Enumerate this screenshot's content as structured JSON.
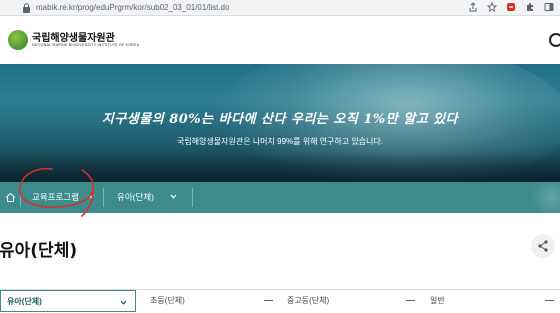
{
  "browser": {
    "url": "mabik.re.kr/prog/eduPrgrm/kor/sub02_03_01/01/list.do"
  },
  "header": {
    "logo_name": "국립해양생물자원관",
    "logo_subtitle": "NATIONAL MARINE BIODIVERSITY INSTITUTE OF KOREA"
  },
  "hero": {
    "title": "지구생물의 80%는 바다에 산다 우리는 오직 1%만 알고 있다",
    "subtitle": "국립해양생물자원관은 나머지 99%를 위해 연구하고 있습니다."
  },
  "nav": {
    "primary_label": "교육프로그램",
    "secondary_label": "유아(단체)"
  },
  "page": {
    "title": "유아(단체)"
  },
  "tabs": [
    {
      "label": "유아(단체)",
      "active": true
    },
    {
      "label": "초등(단체)",
      "active": false
    },
    {
      "label": "중고등(단체)",
      "active": false
    },
    {
      "label": "일반",
      "active": false
    }
  ],
  "colors": {
    "accent": "#3d8c8c",
    "annotation": "#d32f2f"
  }
}
